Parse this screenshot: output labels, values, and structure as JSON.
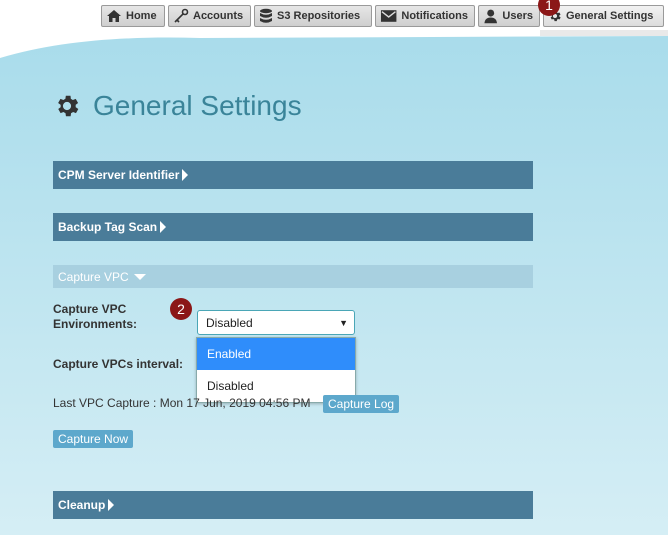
{
  "nav": {
    "tabs": [
      {
        "label": "Home",
        "icon": "home-icon"
      },
      {
        "label": "Accounts",
        "icon": "key-icon"
      },
      {
        "label": "S3 Repositories",
        "icon": "database-icon"
      },
      {
        "label": "Notifications",
        "icon": "envelope-icon"
      },
      {
        "label": "Users",
        "icon": "user-icon"
      },
      {
        "label": "General Settings",
        "icon": "gear-icon"
      }
    ]
  },
  "badges": {
    "one": "1",
    "two": "2"
  },
  "page": {
    "title": "General Settings"
  },
  "sections": {
    "cpm": "CPM Server Identifier",
    "backup": "Backup Tag Scan",
    "capture": "Capture VPC",
    "cleanup": "Cleanup"
  },
  "capture_vpc": {
    "env_label": "Capture VPC Environments:",
    "selected": "Disabled",
    "options": [
      "Enabled",
      "Disabled"
    ],
    "interval_label": "Capture VPCs interval:",
    "last_capture": "Last VPC Capture : Mon 17 Jun, 2019 04:56 PM",
    "log_button": "Capture Log",
    "now_button": "Capture Now"
  },
  "colors": {
    "accent": "#3a8499",
    "bar": "#4a7c99",
    "highlight": "#2f8dfb",
    "badge": "#8b1717"
  }
}
